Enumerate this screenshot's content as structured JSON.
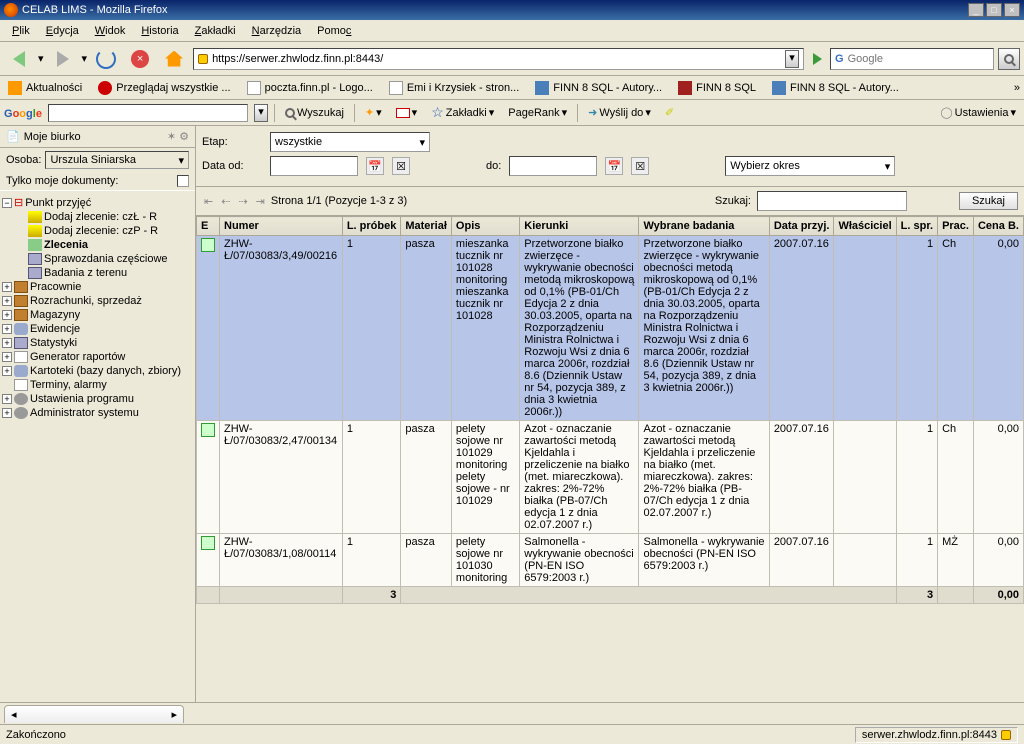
{
  "window_title": "CELAB LIMS - Mozilla Firefox",
  "menubar": [
    "Plik",
    "Edycja",
    "Widok",
    "Historia",
    "Zakładki",
    "Narzędzia",
    "Pomoc"
  ],
  "url": "https://serwer.zhwlodz.finn.pl:8443/",
  "search_placeholder": "Google",
  "bookmarks": [
    {
      "label": "Aktualności",
      "icon": "rss"
    },
    {
      "label": "Przeglądaj wszystkie ...",
      "icon": "red"
    },
    {
      "label": "poczta.finn.pl - Logo...",
      "icon": "doc"
    },
    {
      "label": "Emi i Krzysiek - stron...",
      "icon": "doc"
    },
    {
      "label": "FINN 8 SQL - Autory...",
      "icon": "finn"
    },
    {
      "label": "FINN 8 SQL",
      "icon": "finn-red"
    },
    {
      "label": "FINN 8 SQL - Autory...",
      "icon": "finn"
    }
  ],
  "googlebar": {
    "search_btn": "Wyszukaj",
    "btns": [
      "Zakładki",
      "PageRank",
      "Wyślij do"
    ],
    "settings": "Ustawienia"
  },
  "sidebar": {
    "title": "Moje biurko",
    "person_label": "Osoba:",
    "person_value": "Urszula Siniarska",
    "only_mine": "Tylko moje dokumenty:",
    "tree_root": "Punkt przyjęć",
    "root_children": [
      "Dodaj zlecenie: czŁ - R",
      "Dodaj zlecenie: czP - R",
      "Zlecenia",
      "Sprawozdania częściowe",
      "Badania z terenu"
    ],
    "root_selected_idx": 2,
    "items": [
      "Pracownie",
      "Rozrachunki, sprzedaż",
      "Magazyny",
      "Ewidencje",
      "Statystyki",
      "Generator raportów",
      "Kartoteki (bazy danych, zbiory)",
      "Terminy, alarmy",
      "Ustawienia programu",
      "Administrator systemu"
    ]
  },
  "filter": {
    "etap_label": "Etap:",
    "etap_value": "wszystkie",
    "data_od_label": "Data od:",
    "do_label": "do:",
    "okres_value": "Wybierz okres",
    "pager": "Strona 1/1 (Pozycje 1-3 z 3)",
    "szukaj_label": "Szukaj:",
    "szukaj_btn": "Szukaj"
  },
  "columns": [
    "E",
    "Numer",
    "L. próbek",
    "Materiał",
    "Opis",
    "Kierunki",
    "Wybrane badania",
    "Data przyj.",
    "Właściciel",
    "L. spr.",
    "Prac.",
    "Cena B."
  ],
  "rows": [
    {
      "numer": "ZHW-Ł/07/03083/3,49/00216",
      "lprobek": "1",
      "mat": "pasza",
      "opis": "mieszanka tucznik nr 101028 monitoring mieszanka tucznik nr 101028",
      "kier": "Przetworzone białko zwierzęce - wykrywanie obecności metodą mikroskopową od 0,1% (PB-01/Ch Edycja 2 z dnia 30.03.2005, oparta na Rozporządzeniu Ministra Rolnictwa i Rozwoju Wsi z dnia 6 marca 2006r, rozdział 8.6 (Dziennik Ustaw nr 54, pozycja 389, z dnia 3 kwietnia 2006r.))",
      "bad": "Przetworzone białko zwierzęce - wykrywanie obecności metodą mikroskopową od 0,1% (PB-01/Ch Edycja 2 z dnia 30.03.2005, oparta na Rozporządzeniu Ministra Rolnictwa i Rozwoju Wsi z dnia 6 marca 2006r, rozdział 8.6 (Dziennik Ustaw nr 54, pozycja 389, z dnia 3 kwietnia 2006r.))",
      "data": "2007.07.16",
      "wlasc": "",
      "lspr": "1",
      "prac": "Ch",
      "cena": "0,00"
    },
    {
      "numer": "ZHW-Ł/07/03083/2,47/00134",
      "lprobek": "1",
      "mat": "pasza",
      "opis": "pelety sojowe nr 101029 monitoring pelety sojowe - nr 101029",
      "kier": "Azot - oznaczanie zawartości metodą Kjeldahla i przeliczenie na białko (met. miareczkowa). zakres: 2%-72% białka (PB-07/Ch edycja 1 z dnia 02.07.2007 r.)",
      "bad": "Azot - oznaczanie zawartości metodą Kjeldahla i przeliczenie na białko (met. miareczkowa). zakres: 2%-72% białka (PB-07/Ch edycja 1 z dnia 02.07.2007 r.)",
      "data": "2007.07.16",
      "wlasc": "",
      "lspr": "1",
      "prac": "Ch",
      "cena": "0,00"
    },
    {
      "numer": "ZHW-Ł/07/03083/1,08/00114",
      "lprobek": "1",
      "mat": "pasza",
      "opis": "pelety sojowe nr 101030 monitoring",
      "kier": "Salmonella - wykrywanie obecności (PN-EN ISO 6579:2003 r.)",
      "bad": "Salmonella - wykrywanie obecności (PN-EN ISO 6579:2003 r.)",
      "data": "2007.07.16",
      "wlasc": "",
      "lspr": "1",
      "prac": "MŻ",
      "cena": "0,00"
    }
  ],
  "footer": {
    "lprobek": "3",
    "lspr": "3",
    "cena": "0,00"
  },
  "status": {
    "left": "Zakończono",
    "right": "serwer.zhwlodz.finn.pl:8443"
  }
}
